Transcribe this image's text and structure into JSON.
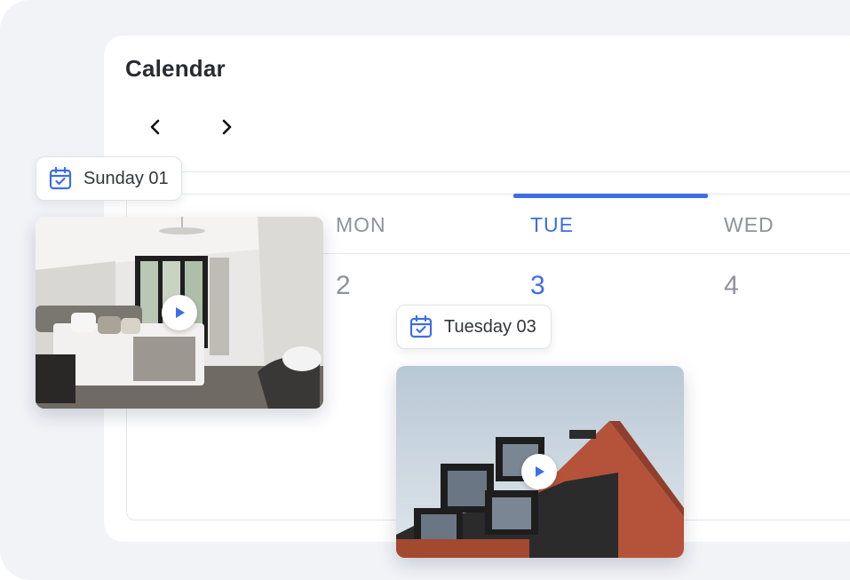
{
  "calendar": {
    "title": "Calendar",
    "days": [
      {
        "label": "MON",
        "number": "2",
        "active": false
      },
      {
        "label": "TUE",
        "number": "3",
        "active": true
      },
      {
        "label": "WED",
        "number": "4",
        "active": false
      }
    ]
  },
  "navigation": {
    "prev_icon": "chevron-left-icon",
    "next_icon": "chevron-right-icon"
  },
  "events": [
    {
      "date_label": "Sunday 01",
      "icon": "calendar-check-icon",
      "media": "bedroom-video",
      "play_icon": "play-icon"
    },
    {
      "date_label": "Tuesday 03",
      "icon": "calendar-check-icon",
      "media": "building-video",
      "play_icon": "play-icon"
    }
  ],
  "colors": {
    "accent": "#3d6ee6",
    "muted_text": "#8f929a",
    "title_text": "#2a2a33",
    "background": "#f1f3f7"
  }
}
